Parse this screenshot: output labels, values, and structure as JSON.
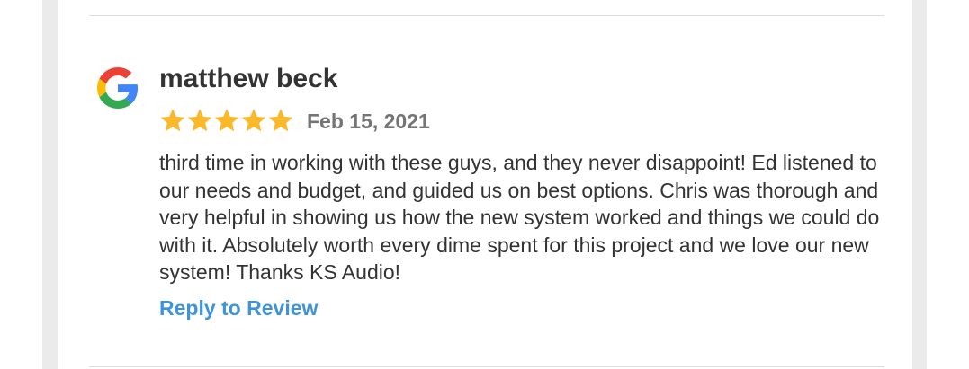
{
  "review": {
    "source_icon": "google-g-icon",
    "author": "matthew beck",
    "rating": 5,
    "rating_max": 5,
    "date": "Feb 15, 2021",
    "text": "third time in working with these guys, and they never disappoint! Ed listened to our needs and budget, and guided us on best options. Chris was thorough and very helpful in showing us how the new system worked and things we could do with it. Absolutely worth every dime spent for this project and we love our new system! Thanks KS Audio!",
    "reply_label": "Reply to Review"
  },
  "colors": {
    "star": "#f9b92b",
    "link": "#3d94d9",
    "author": "#333333",
    "date": "#757575",
    "google_blue": "#4285f4",
    "google_red": "#ea4335",
    "google_yellow": "#fbbc05",
    "google_green": "#34a853"
  }
}
